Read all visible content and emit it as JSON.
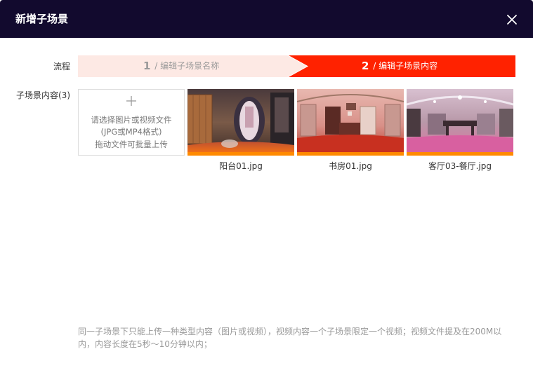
{
  "dialog": {
    "title": "新增子场景",
    "close_icon": "close-icon"
  },
  "form": {
    "flow_label": "流程",
    "content_label": "子场景内容(3)"
  },
  "steps": [
    {
      "number": "1",
      "label": "/ 编辑子场景名称",
      "state": "done",
      "color": "#fde9e4"
    },
    {
      "number": "2",
      "label": "/ 编辑子场景内容",
      "state": "active",
      "color": "#ff2200"
    }
  ],
  "upload": {
    "icon": "plus-icon",
    "line1": "请选择图片或视频文件",
    "line2": "(JPG或MP4格式)",
    "line3": "拖动文件可批量上传"
  },
  "items": [
    {
      "name": "阳台01.jpg"
    },
    {
      "name": "书房01.jpg"
    },
    {
      "name": "客厅03-餐厅.jpg"
    }
  ],
  "note": "同一子场景下只能上传一种类型内容（图片或视频），视频内容一个子场景限定一个视频；视频文件提及在200M以内，内容长度在5秒～10分钟以内；",
  "colors": {
    "header_bg": "#120a2e",
    "accent": "#ff2200",
    "step_done_bg": "#fde9e4"
  }
}
